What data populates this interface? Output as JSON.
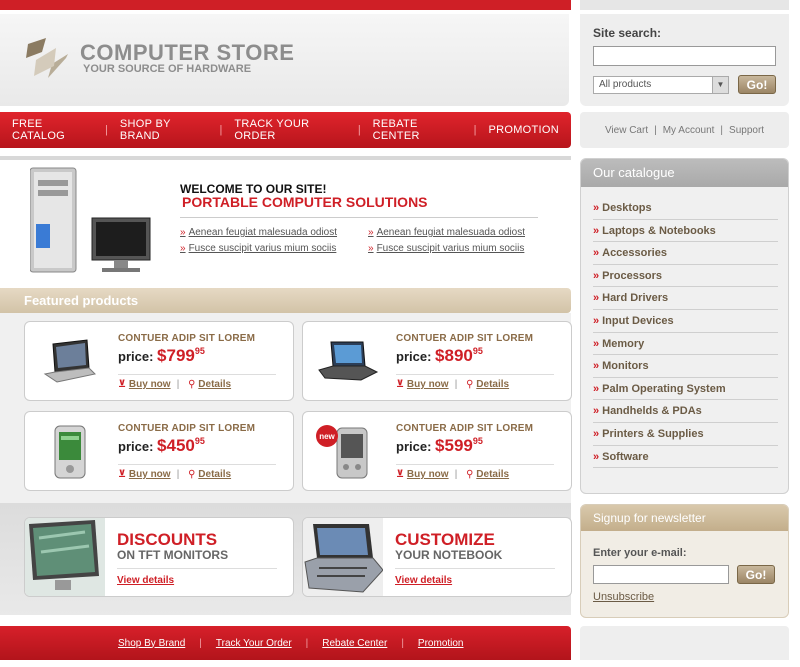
{
  "header": {
    "store_title": "COMPUTER STORE",
    "store_subtitle": "YOUR SOURCE OF HARDWARE"
  },
  "search": {
    "label": "Site search:",
    "input_value": "",
    "category_selected": "All products",
    "go_label": "Go!"
  },
  "nav": {
    "items": [
      {
        "label": "FREE CATALOG"
      },
      {
        "label": "SHOP BY BRAND"
      },
      {
        "label": "TRACK YOUR ORDER"
      },
      {
        "label": "REBATE CENTER"
      },
      {
        "label": "PROMOTION"
      }
    ]
  },
  "utility": {
    "view_cart": "View Cart",
    "my_account": "My Account",
    "support": "Support"
  },
  "welcome": {
    "title": "WELCOME TO OUR SITE!",
    "subtitle": "PORTABLE COMPUTER SOLUTIONS",
    "links": [
      "Aenean  feugiat malesuada odiost",
      "Aenean  feugiat malesuada odiost",
      "Fusce suscipit varius mium sociis",
      "Fusce suscipit varius mium sociis"
    ]
  },
  "featured": {
    "title": "Featured products",
    "price_label": "price:",
    "buy_label": "Buy now",
    "details_label": "Details",
    "products": [
      {
        "name": "CONTUER ADIP SIT LOREM",
        "price": "$799",
        "cents": "95",
        "icon": "laptop-icon"
      },
      {
        "name": "CONTUER ADIP SIT LOREM",
        "price": "$890",
        "cents": "95",
        "icon": "laptop-icon"
      },
      {
        "name": "CONTUER ADIP SIT LOREM",
        "price": "$450",
        "cents": "95",
        "icon": "pda-icon"
      },
      {
        "name": "CONTUER ADIP SIT LOREM",
        "price": "$599",
        "cents": "95",
        "icon": "pda-icon",
        "badge": "new"
      }
    ]
  },
  "promos": [
    {
      "title": "DISCOUNTS",
      "subtitle": "ON TFT MONITORS",
      "link": "View details"
    },
    {
      "title": "CUSTOMIZE",
      "subtitle": "YOUR NOTEBOOK",
      "link": "View details"
    }
  ],
  "catalogue": {
    "title": "Our catalogue",
    "items": [
      "Desktops",
      "Laptops & Notebooks",
      "Accessories",
      "Processors",
      "Hard Drivers",
      "Input Devices",
      "Memory",
      "Monitors",
      "Palm Operating System",
      "Handhelds & PDAs",
      "Printers & Supplies",
      "Software"
    ]
  },
  "newsletter": {
    "title": "Signup for newsletter",
    "label": "Enter your e-mail:",
    "input_value": "",
    "go_label": "Go!",
    "unsubscribe": "Unsubscribe"
  },
  "footer": {
    "links": [
      "Shop By Brand",
      "Track Your Order",
      "Rebate Center",
      "Promotion"
    ]
  },
  "colors": {
    "brand_red": "#cf1f26",
    "accent_tan": "#c3ae8b"
  }
}
